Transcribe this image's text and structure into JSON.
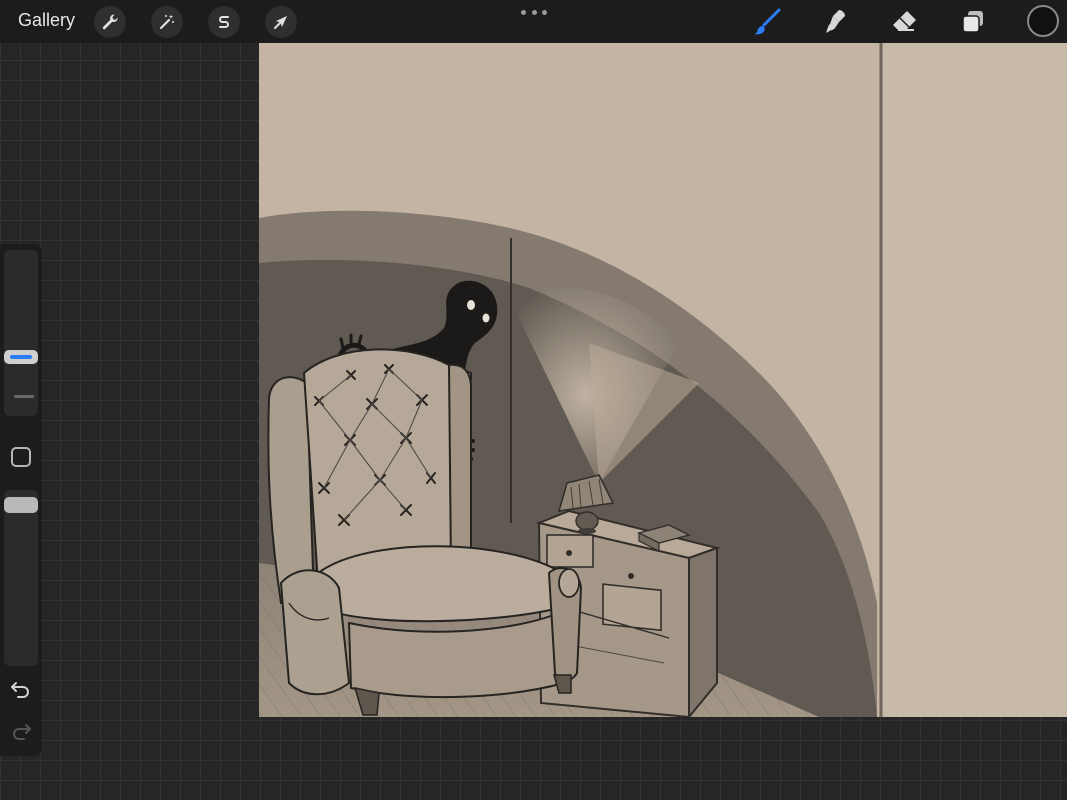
{
  "app": {
    "gallery_label": "Gallery"
  },
  "toolbar": {
    "left_tools": [
      {
        "name": "actions",
        "icon": "wrench-icon"
      },
      {
        "name": "adjustments",
        "icon": "magic-wand-icon"
      },
      {
        "name": "selection",
        "icon": "selection-s-icon"
      },
      {
        "name": "transform",
        "icon": "arrow-cursor-icon"
      }
    ],
    "more_icon": "ellipsis-icon",
    "right_tools": [
      {
        "name": "brush",
        "icon": "brush-icon",
        "active": true
      },
      {
        "name": "smudge",
        "icon": "smudge-icon",
        "active": false
      },
      {
        "name": "eraser",
        "icon": "eraser-icon",
        "active": false
      },
      {
        "name": "layers",
        "icon": "layers-icon",
        "active": false
      }
    ],
    "current_color": "#111111",
    "accent_color": "#2c7cf6"
  },
  "sidebar": {
    "brush_size_slider": "brush-size",
    "brush_opacity_slider": "brush-opacity",
    "modify_button_icon": "square-icon",
    "undo_icon": "undo-icon",
    "redo_icon": "redo-icon"
  },
  "canvas": {
    "paper_color": "#c2b2a0",
    "content": "pencil-sketch-armchair-shadow-figure"
  }
}
